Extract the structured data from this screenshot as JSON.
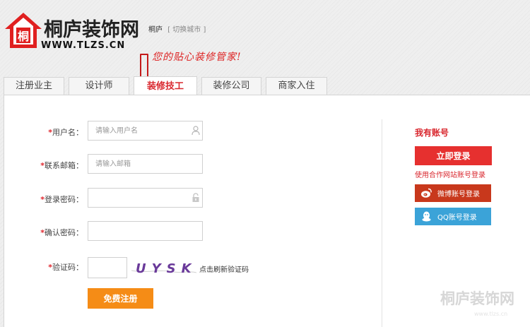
{
  "header": {
    "logo_title": "桐庐装饰网",
    "logo_domain": "WWW.TLZS.CN",
    "logo_house_char": "桐",
    "city": "桐庐",
    "city_switch": "[ 切换城市 ]",
    "slogan": "您的贴心装修管家!"
  },
  "tabs": [
    {
      "label": "注册业主",
      "active": false
    },
    {
      "label": "设计师",
      "active": false
    },
    {
      "label": "装修技工",
      "active": true
    },
    {
      "label": "装修公司",
      "active": false
    },
    {
      "label": "商家入住",
      "active": false
    }
  ],
  "form": {
    "required_mark": "*",
    "username": {
      "label": "用户名：",
      "placeholder": "请输入用户名",
      "icon": "user-icon"
    },
    "email": {
      "label": "联系邮箱：",
      "placeholder": "请输入邮箱"
    },
    "password": {
      "label": "登录密码：",
      "placeholder": "",
      "icon": "lock-icon"
    },
    "confirm": {
      "label": "确认密码：",
      "placeholder": ""
    },
    "captcha": {
      "label": "验证码：",
      "code": "UYSK",
      "refresh_text": "点击刷新验证码"
    },
    "submit_label": "免费注册"
  },
  "sidebar": {
    "title": "我有账号",
    "login_label": "立即登录",
    "partner_note": "使用合作网站账号登录",
    "weibo_label": "微博账号登录",
    "qq_label": "QQ账号登录"
  },
  "watermark": {
    "text": "桐庐装饰网",
    "sub": "www.tlzs.cn"
  },
  "colors": {
    "brand_red": "#d9272e",
    "submit_orange": "#f58c16",
    "weibo_red": "#c8381c",
    "qq_blue": "#3ba3d8"
  }
}
